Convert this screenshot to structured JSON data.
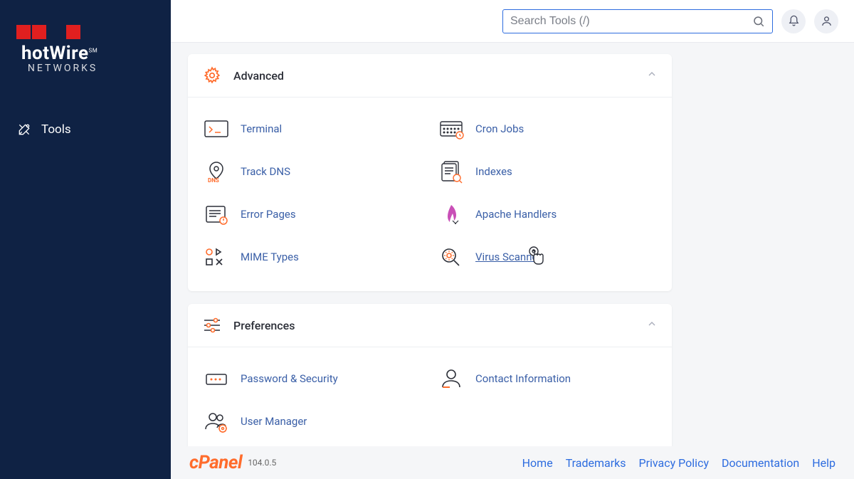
{
  "brand": {
    "name_main": "hotWire",
    "name_sub": "NETWORKS",
    "sm": "SM"
  },
  "sidebar": {
    "items": [
      {
        "label": "Tools"
      }
    ]
  },
  "search": {
    "placeholder": "Search Tools (/)"
  },
  "sections": [
    {
      "title": "Advanced",
      "items": [
        {
          "label": "Terminal",
          "icon": "terminal-icon"
        },
        {
          "label": "Cron Jobs",
          "icon": "cron-icon"
        },
        {
          "label": "Track DNS",
          "icon": "dns-icon"
        },
        {
          "label": "Indexes",
          "icon": "indexes-icon"
        },
        {
          "label": "Error Pages",
          "icon": "errorpages-icon"
        },
        {
          "label": "Apache Handlers",
          "icon": "apache-icon"
        },
        {
          "label": "MIME Types",
          "icon": "mime-icon"
        },
        {
          "label": "Virus Scanner",
          "icon": "virus-icon",
          "underline": true,
          "cursor": true
        }
      ]
    },
    {
      "title": "Preferences",
      "items": [
        {
          "label": "Password & Security",
          "icon": "password-icon"
        },
        {
          "label": "Contact Information",
          "icon": "contact-icon"
        },
        {
          "label": "User Manager",
          "icon": "usermgr-icon"
        }
      ]
    }
  ],
  "footer": {
    "brand": "cPanel",
    "version": "104.0.5",
    "links": [
      {
        "label": "Home"
      },
      {
        "label": "Trademarks"
      },
      {
        "label": "Privacy Policy"
      },
      {
        "label": "Documentation"
      },
      {
        "label": "Help"
      }
    ]
  }
}
